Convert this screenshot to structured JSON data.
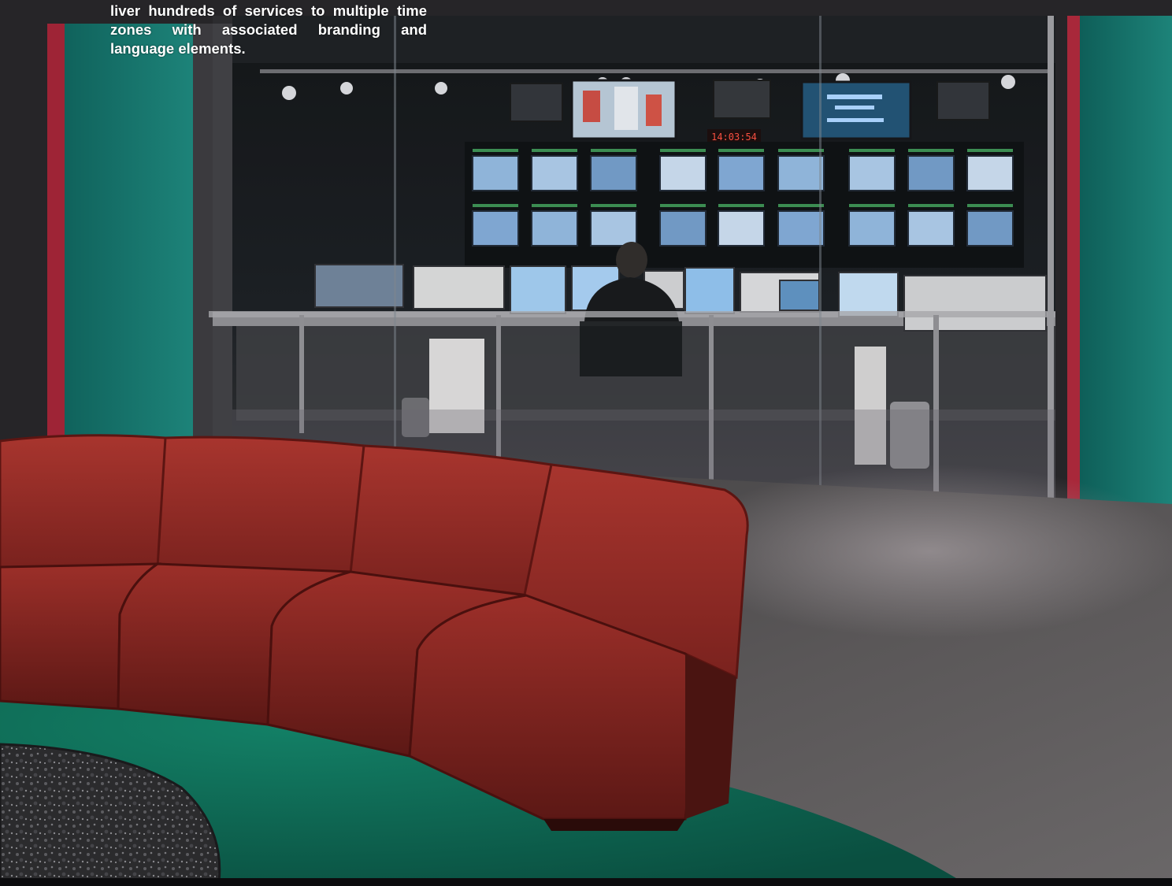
{
  "caption": {
    "text": "liver hundreds of services to multiple time zones with associated branding and language elements."
  },
  "scene": {
    "clock_readout": "14:03:54",
    "colors": {
      "wall_teal": "#1f8a80",
      "sofa_red": "#8e2a25",
      "carpet_gray": "#4a4848",
      "rug_green": "#0f6a55",
      "door_frame_red": "#a8283a",
      "monitor_glow": "#7fb6e6"
    }
  }
}
